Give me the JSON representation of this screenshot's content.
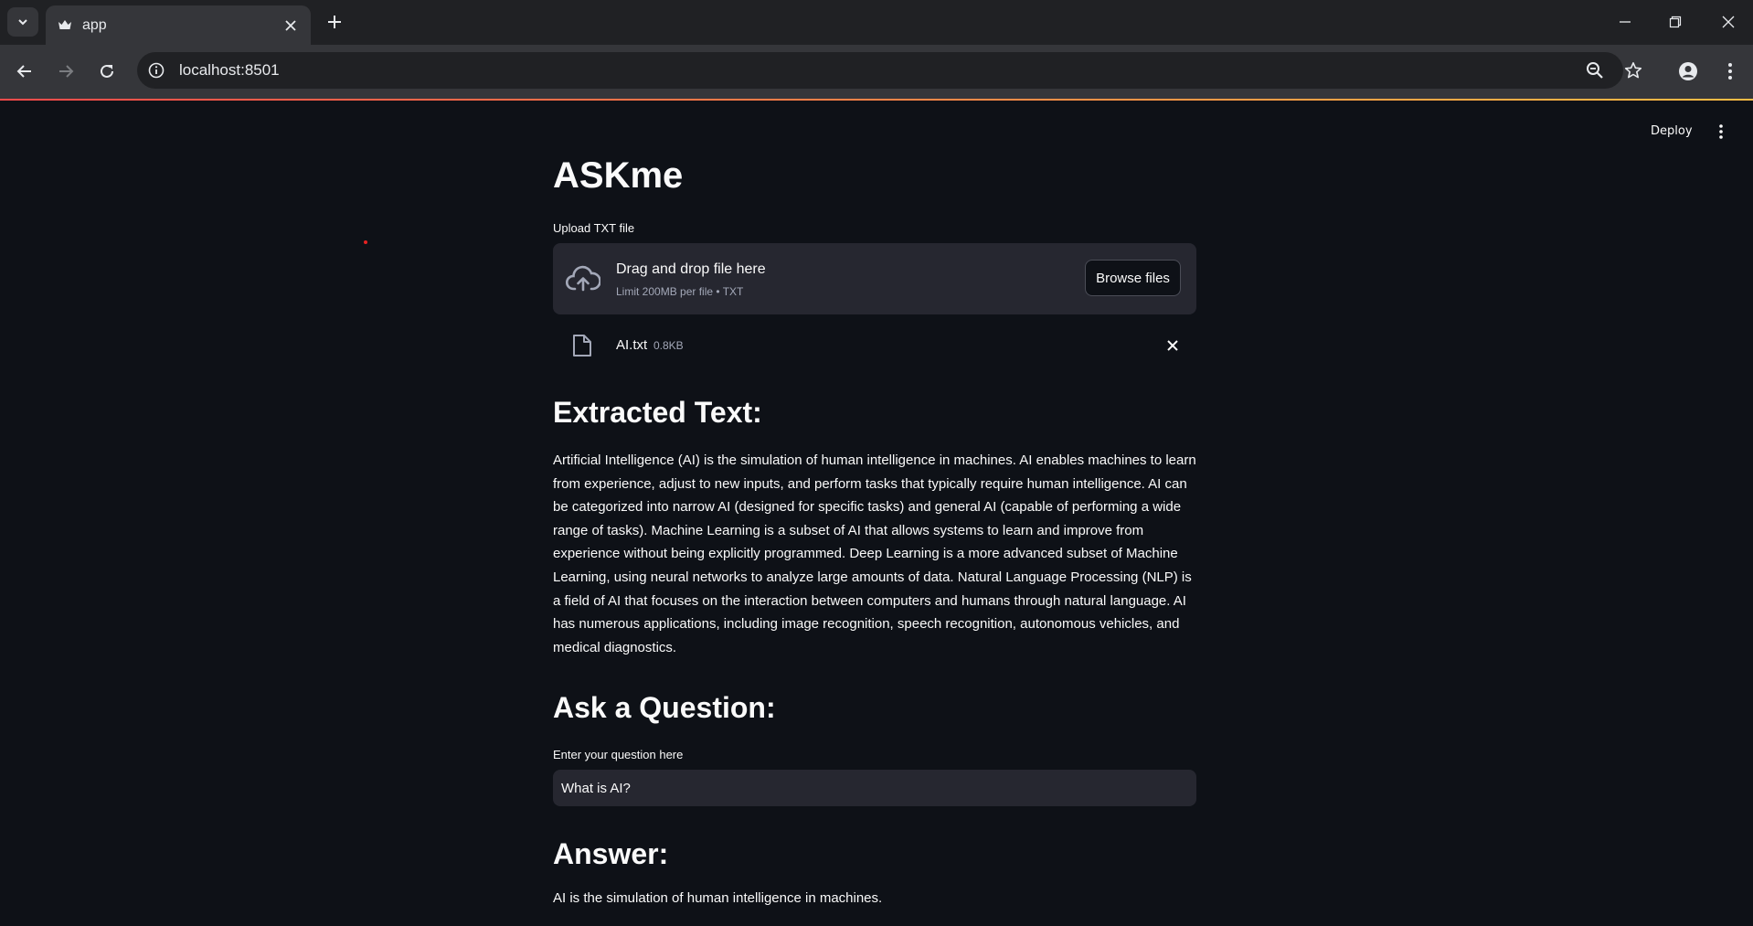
{
  "browser": {
    "tab_title": "app",
    "url": "localhost:8501",
    "icons": {
      "tab_search": "chevron-down-icon",
      "favicon": "crown-icon",
      "tab_close": "close-icon",
      "new_tab": "plus-icon",
      "back": "arrow-left-icon",
      "forward": "arrow-right-icon",
      "reload": "reload-icon",
      "site_info": "info-icon",
      "zoom": "zoom-out-icon",
      "bookmark": "star-icon",
      "profile": "profile-icon",
      "menu": "kebab-menu-icon"
    }
  },
  "app": {
    "deploy_label": "Deploy",
    "title": "ASKme",
    "uploader": {
      "label": "Upload TXT file",
      "drop_title": "Drag and drop file here",
      "drop_subtitle": "Limit 200MB per file • TXT",
      "browse_label": "Browse files"
    },
    "file": {
      "name": "AI.txt",
      "size": "0.8KB"
    },
    "extracted": {
      "heading": "Extracted Text:",
      "text": "Artificial Intelligence (AI) is the simulation of human intelligence in machines. AI enables machines to learn from experience, adjust to new inputs, and perform tasks that typically require human intelligence. AI can be categorized into narrow AI (designed for specific tasks) and general AI (capable of performing a wide range of tasks). Machine Learning is a subset of AI that allows systems to learn and improve from experience without being explicitly programmed. Deep Learning is a more advanced subset of Machine Learning, using neural networks to analyze large amounts of data. Natural Language Processing (NLP) is a field of AI that focuses on the interaction between computers and humans through natural language. AI has numerous applications, including image recognition, speech recognition, autonomous vehicles, and medical diagnostics."
    },
    "question": {
      "heading": "Ask a Question:",
      "label": "Enter your question here",
      "value": "What is AI?"
    },
    "answer": {
      "heading": "Answer:",
      "text": "AI is the simulation of human intelligence in machines."
    }
  },
  "colors": {
    "background": "#0e1117",
    "widget": "#262730",
    "text": "#fafafa",
    "muted": "#a3a8b8",
    "chrome_dark": "#202124",
    "chrome_light": "#35363a",
    "accent_red": "#ff4b4b",
    "accent_yellow": "#ffbd45"
  }
}
